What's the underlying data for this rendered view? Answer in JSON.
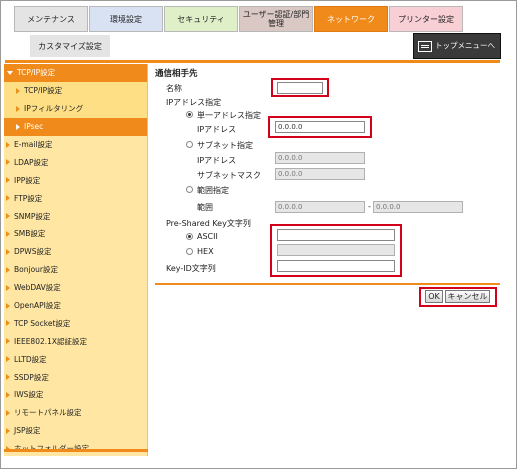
{
  "tabs": [
    {
      "label": "メンテナンス"
    },
    {
      "label": "環境設定"
    },
    {
      "label": "セキュリティ"
    },
    {
      "label": "ユーザー認証/部門管理"
    },
    {
      "label": "ネットワーク"
    },
    {
      "label": "プリンター設定"
    }
  ],
  "subtab": {
    "label": "カスタマイズ設定"
  },
  "top_menu": {
    "label": "トップメニューへ"
  },
  "sidebar": {
    "items": [
      {
        "label": "TCP/IP設定"
      },
      {
        "label": "TCP/IP設定"
      },
      {
        "label": "IPフィルタリング"
      },
      {
        "label": "IPsec"
      },
      {
        "label": "E-mail設定"
      },
      {
        "label": "LDAP設定"
      },
      {
        "label": "IPP設定"
      },
      {
        "label": "FTP設定"
      },
      {
        "label": "SNMP設定"
      },
      {
        "label": "SMB設定"
      },
      {
        "label": "DPWS設定"
      },
      {
        "label": "Bonjour設定"
      },
      {
        "label": "WebDAV設定"
      },
      {
        "label": "OpenAPI設定"
      },
      {
        "label": "TCP Socket設定"
      },
      {
        "label": "IEEE802.1X認証設定"
      },
      {
        "label": "LLTD設定"
      },
      {
        "label": "SSDP設定"
      },
      {
        "label": "IWS設定"
      },
      {
        "label": "リモートパネル設定"
      },
      {
        "label": "JSP設定"
      },
      {
        "label": "ホットフォルダー設定"
      }
    ]
  },
  "form": {
    "section_title": "通信相手先",
    "name_label": "名称",
    "name_value": "",
    "ip_label": "IPアドレス指定",
    "single_label": "単一アドレス指定",
    "single_ip_label": "IPアドレス",
    "single_ip_value": "0.0.0.0",
    "subnet_label": "サブネット指定",
    "subnet_ip_label": "IPアドレス",
    "subnet_ip_value": "0.0.0.0",
    "subnet_mask_label": "サブネットマスク",
    "subnet_mask_value": "0.0.0.0",
    "range_label": "範囲指定",
    "range_sub_label": "範囲",
    "range_from": "0.0.0.0",
    "range_sep": "-",
    "range_to": "0.0.0.0",
    "psk_label": "Pre-Shared Key文字列",
    "ascii_label": "ASCII",
    "ascii_value": "",
    "hex_label": "HEX",
    "hex_value": "",
    "keyid_label": "Key-ID文字列",
    "keyid_value": ""
  },
  "buttons": {
    "ok": "OK",
    "cancel": "キャンセル"
  },
  "colors": {
    "accent": "#f08a1a",
    "highlight": "#d4001a",
    "sidebar_bg": "#ffe7a3"
  }
}
